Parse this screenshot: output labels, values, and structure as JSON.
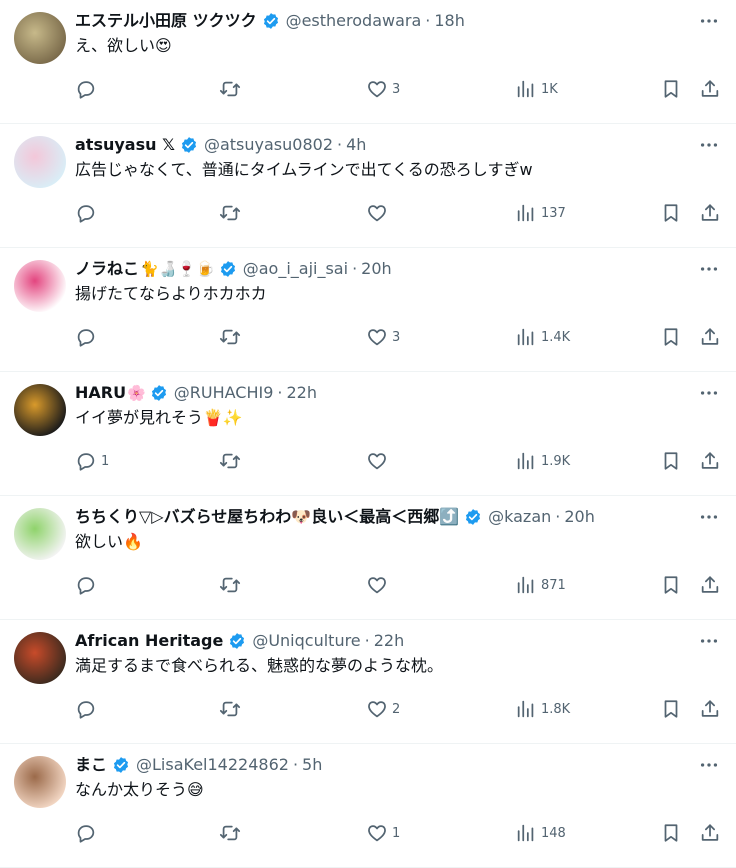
{
  "tweets": [
    {
      "name": "エステル小田原 ツクツク",
      "name_emoji": "",
      "handle": "@estherodawara",
      "time": "18h",
      "text": "え、欲しい😍",
      "replies": "",
      "retweets": "",
      "likes": "3",
      "views": "1K",
      "avatar_colors": [
        "#7a6a4a",
        "#c7b98a"
      ]
    },
    {
      "name": "atsuyasu 𝕏",
      "name_emoji": "",
      "handle": "@atsuyasu0802",
      "time": "4h",
      "text": "広告じゃなくて、普通にタイムラインで出てくるの恐ろしすぎw",
      "replies": "",
      "retweets": "",
      "likes": "",
      "views": "137",
      "avatar_colors": [
        "#d9eef7",
        "#f3c7d9"
      ]
    },
    {
      "name": "ノラねこ",
      "name_emoji": "🐈🍶🍷🍺",
      "handle": "@ao_i_aji_sai",
      "time": "20h",
      "text": "揚げたてならよりホカホカ",
      "replies": "",
      "retweets": "",
      "likes": "3",
      "views": "1.4K",
      "avatar_colors": [
        "#ffffff",
        "#e3457f"
      ]
    },
    {
      "name": "HARU",
      "name_emoji": "🌸",
      "handle": "@RUHACHI9",
      "time": "22h",
      "text": "イイ夢が見れそう🍟✨",
      "replies": "1",
      "retweets": "",
      "likes": "",
      "views": "1.9K",
      "avatar_colors": [
        "#1a1a1a",
        "#d99a2b"
      ]
    },
    {
      "name": "ちちくり▽▷バズらせ屋ちわわ🐶良い＜最高＜西郷⤴️",
      "name_emoji": "",
      "handle": "@kazan",
      "time": "20h",
      "text": "欲しい🔥",
      "replies": "",
      "retweets": "",
      "likes": "",
      "views": "871",
      "avatar_colors": [
        "#f4f4f4",
        "#8fd36b"
      ]
    },
    {
      "name": "African Heritage",
      "name_emoji": "",
      "handle": "@Uniqculture",
      "time": "22h",
      "text": "満足するまで食べられる、魅惑的な夢のような枕。",
      "replies": "",
      "retweets": "",
      "likes": "2",
      "views": "1.8K",
      "avatar_colors": [
        "#3b2a1e",
        "#c84b2a"
      ]
    },
    {
      "name": "まこ",
      "name_emoji": "",
      "handle": "@LisaKel14224862",
      "time": "5h",
      "text": "なんか太りそう😅",
      "replies": "",
      "retweets": "",
      "likes": "1",
      "views": "148",
      "avatar_colors": [
        "#f3d7c4",
        "#9b6a4a"
      ]
    }
  ],
  "colors": {
    "text": "#0f1419",
    "secondary": "#536471",
    "verified": "#1d9bf0",
    "divider": "#eff3f4"
  },
  "icons": [
    "reply-icon",
    "retweet-icon",
    "like-icon",
    "views-icon",
    "bookmark-icon",
    "share-icon",
    "more-icon",
    "verified-badge-icon"
  ]
}
